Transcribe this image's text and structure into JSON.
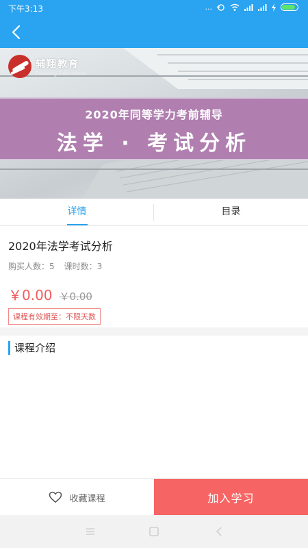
{
  "status_bar": {
    "time": "下午3:13",
    "dots": "...",
    "battery_color": "#5ee46a"
  },
  "nav": {
    "back_icon": "chevron-left-icon"
  },
  "banner": {
    "logo_text": "辅翔教育",
    "logo_subtext": "Fuxiang Education",
    "subtitle": "2020年同等学力考前辅导",
    "title": "法学 · 考试分析"
  },
  "tabs": [
    {
      "label": "详情",
      "active": true
    },
    {
      "label": "目录",
      "active": false
    }
  ],
  "course": {
    "title": "2020年法学考试分析",
    "buyers": "购买人数：5",
    "lessons": "课时数：3",
    "price": "￥0.00",
    "original_price": "￥0.00",
    "validity": "课程有效期至：不限天数"
  },
  "intro": {
    "heading": "课程介绍"
  },
  "bottom_bar": {
    "favorite_label": "收藏课程",
    "favorite_icon": "heart-icon",
    "join_label": "加入学习"
  },
  "colors": {
    "primary": "#2aa3f0",
    "price": "#f25c5c",
    "join_button": "#f76464",
    "banner_band": "#b07fb0"
  }
}
